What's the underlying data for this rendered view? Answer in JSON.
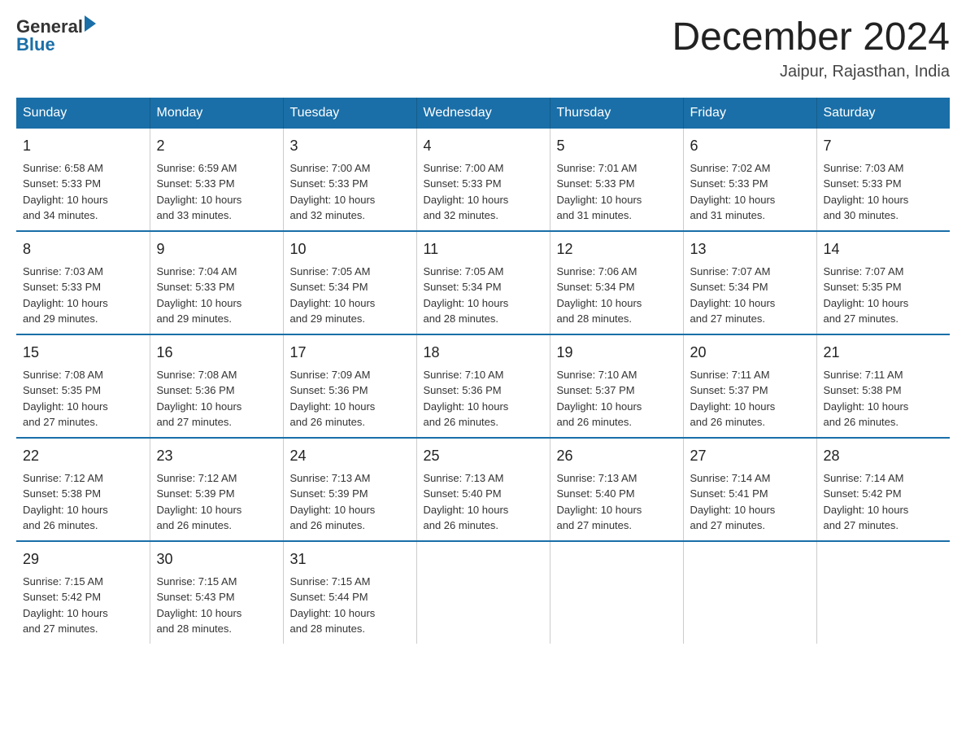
{
  "header": {
    "logo_text_general": "General",
    "logo_text_blue": "Blue",
    "title": "December 2024",
    "subtitle": "Jaipur, Rajasthan, India"
  },
  "days_of_week": [
    "Sunday",
    "Monday",
    "Tuesday",
    "Wednesday",
    "Thursday",
    "Friday",
    "Saturday"
  ],
  "weeks": [
    [
      {
        "day": "1",
        "sunrise": "6:58 AM",
        "sunset": "5:33 PM",
        "daylight": "10 hours and 34 minutes."
      },
      {
        "day": "2",
        "sunrise": "6:59 AM",
        "sunset": "5:33 PM",
        "daylight": "10 hours and 33 minutes."
      },
      {
        "day": "3",
        "sunrise": "7:00 AM",
        "sunset": "5:33 PM",
        "daylight": "10 hours and 32 minutes."
      },
      {
        "day": "4",
        "sunrise": "7:00 AM",
        "sunset": "5:33 PM",
        "daylight": "10 hours and 32 minutes."
      },
      {
        "day": "5",
        "sunrise": "7:01 AM",
        "sunset": "5:33 PM",
        "daylight": "10 hours and 31 minutes."
      },
      {
        "day": "6",
        "sunrise": "7:02 AM",
        "sunset": "5:33 PM",
        "daylight": "10 hours and 31 minutes."
      },
      {
        "day": "7",
        "sunrise": "7:03 AM",
        "sunset": "5:33 PM",
        "daylight": "10 hours and 30 minutes."
      }
    ],
    [
      {
        "day": "8",
        "sunrise": "7:03 AM",
        "sunset": "5:33 PM",
        "daylight": "10 hours and 29 minutes."
      },
      {
        "day": "9",
        "sunrise": "7:04 AM",
        "sunset": "5:33 PM",
        "daylight": "10 hours and 29 minutes."
      },
      {
        "day": "10",
        "sunrise": "7:05 AM",
        "sunset": "5:34 PM",
        "daylight": "10 hours and 29 minutes."
      },
      {
        "day": "11",
        "sunrise": "7:05 AM",
        "sunset": "5:34 PM",
        "daylight": "10 hours and 28 minutes."
      },
      {
        "day": "12",
        "sunrise": "7:06 AM",
        "sunset": "5:34 PM",
        "daylight": "10 hours and 28 minutes."
      },
      {
        "day": "13",
        "sunrise": "7:07 AM",
        "sunset": "5:34 PM",
        "daylight": "10 hours and 27 minutes."
      },
      {
        "day": "14",
        "sunrise": "7:07 AM",
        "sunset": "5:35 PM",
        "daylight": "10 hours and 27 minutes."
      }
    ],
    [
      {
        "day": "15",
        "sunrise": "7:08 AM",
        "sunset": "5:35 PM",
        "daylight": "10 hours and 27 minutes."
      },
      {
        "day": "16",
        "sunrise": "7:08 AM",
        "sunset": "5:36 PM",
        "daylight": "10 hours and 27 minutes."
      },
      {
        "day": "17",
        "sunrise": "7:09 AM",
        "sunset": "5:36 PM",
        "daylight": "10 hours and 26 minutes."
      },
      {
        "day": "18",
        "sunrise": "7:10 AM",
        "sunset": "5:36 PM",
        "daylight": "10 hours and 26 minutes."
      },
      {
        "day": "19",
        "sunrise": "7:10 AM",
        "sunset": "5:37 PM",
        "daylight": "10 hours and 26 minutes."
      },
      {
        "day": "20",
        "sunrise": "7:11 AM",
        "sunset": "5:37 PM",
        "daylight": "10 hours and 26 minutes."
      },
      {
        "day": "21",
        "sunrise": "7:11 AM",
        "sunset": "5:38 PM",
        "daylight": "10 hours and 26 minutes."
      }
    ],
    [
      {
        "day": "22",
        "sunrise": "7:12 AM",
        "sunset": "5:38 PM",
        "daylight": "10 hours and 26 minutes."
      },
      {
        "day": "23",
        "sunrise": "7:12 AM",
        "sunset": "5:39 PM",
        "daylight": "10 hours and 26 minutes."
      },
      {
        "day": "24",
        "sunrise": "7:13 AM",
        "sunset": "5:39 PM",
        "daylight": "10 hours and 26 minutes."
      },
      {
        "day": "25",
        "sunrise": "7:13 AM",
        "sunset": "5:40 PM",
        "daylight": "10 hours and 26 minutes."
      },
      {
        "day": "26",
        "sunrise": "7:13 AM",
        "sunset": "5:40 PM",
        "daylight": "10 hours and 27 minutes."
      },
      {
        "day": "27",
        "sunrise": "7:14 AM",
        "sunset": "5:41 PM",
        "daylight": "10 hours and 27 minutes."
      },
      {
        "day": "28",
        "sunrise": "7:14 AM",
        "sunset": "5:42 PM",
        "daylight": "10 hours and 27 minutes."
      }
    ],
    [
      {
        "day": "29",
        "sunrise": "7:15 AM",
        "sunset": "5:42 PM",
        "daylight": "10 hours and 27 minutes."
      },
      {
        "day": "30",
        "sunrise": "7:15 AM",
        "sunset": "5:43 PM",
        "daylight": "10 hours and 28 minutes."
      },
      {
        "day": "31",
        "sunrise": "7:15 AM",
        "sunset": "5:44 PM",
        "daylight": "10 hours and 28 minutes."
      },
      null,
      null,
      null,
      null
    ]
  ],
  "labels": {
    "sunrise": "Sunrise:",
    "sunset": "Sunset:",
    "daylight": "Daylight:"
  }
}
